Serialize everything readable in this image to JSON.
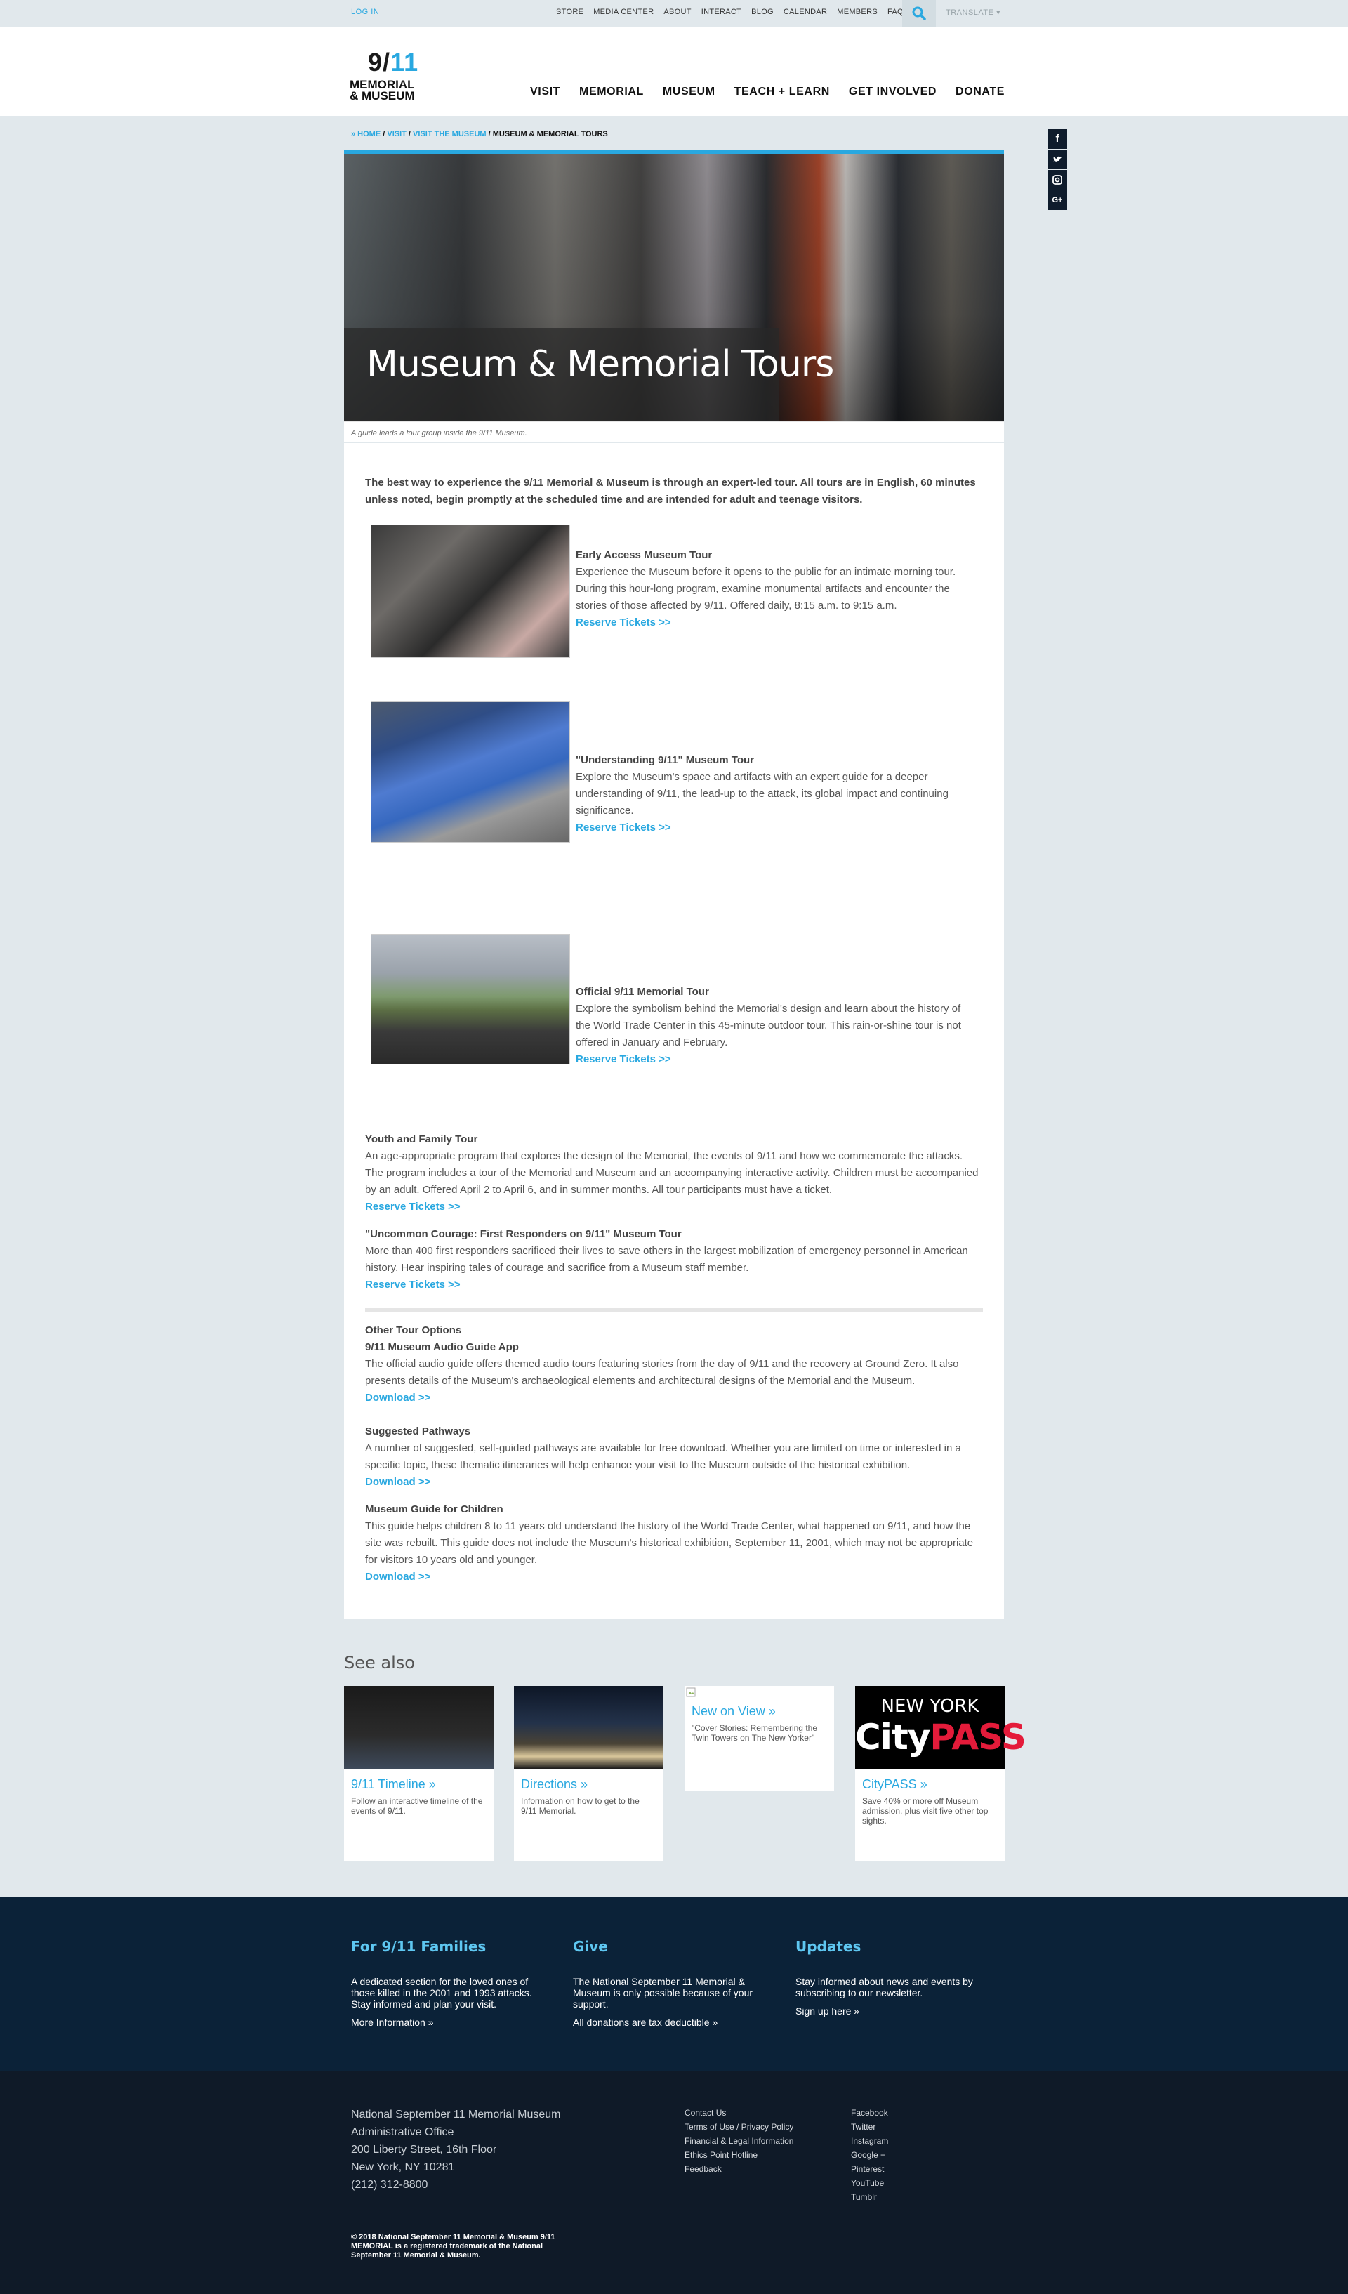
{
  "util": {
    "login": "LOG IN",
    "nav": [
      "STORE",
      "MEDIA CENTER",
      "ABOUT",
      "INTERACT",
      "BLOG",
      "CALENDAR",
      "MEMBERS",
      "FAQ"
    ],
    "translate": "TRANSLATE ▾"
  },
  "logo": {
    "line1": "9/",
    "line1_accent": "11",
    "line2": "MEMORIAL",
    "line3": "& MUSEUM"
  },
  "nav": [
    "VISIT",
    "MEMORIAL",
    "MUSEUM",
    "TEACH + LEARN",
    "GET INVOLVED",
    "DONATE"
  ],
  "social": [
    "f",
    "t",
    "ig",
    "G+"
  ],
  "breadcrumb": {
    "home": "» HOME",
    "sep": " / ",
    "visit": "VISIT",
    "visit_museum": "VISIT THE MUSEUM",
    "current": "MUSEUM & MEMORIAL TOURS"
  },
  "hero": {
    "title": "Museum & Memorial Tours",
    "caption": "A guide leads a tour group inside the 9/11 Museum."
  },
  "intro": "The best way to experience the 9/11 Memorial & Museum is through an expert-led tour. All tours are in English, 60 minutes unless noted, begin promptly at the scheduled time and are intended for adult and teenage visitors.",
  "tours": [
    {
      "title": "Early Access Museum Tour",
      "text": "Experience the Museum before it opens to the public for an intimate morning tour. During this hour-long program, examine monumental artifacts and encounter the stories of those affected by 9/11. Offered daily, 8:15 a.m. to 9:15 a.m.",
      "link": "Reserve Tickets >>"
    },
    {
      "title": "\"Understanding 9/11\" Museum Tour",
      "text": "Explore the Museum's space and artifacts with an expert guide for a deeper understanding of 9/11, the lead-up to the attack, its global impact and continuing significance.",
      "link": "Reserve Tickets >>"
    },
    {
      "title": "Official 9/11 Memorial Tour",
      "text": "Explore the symbolism behind the Memorial's design and learn about the history of the World Trade Center in this 45-minute outdoor tour. This rain-or-shine tour is not offered in January and February.",
      "link": "Reserve Tickets >>"
    },
    {
      "title": "Youth and Family Tour",
      "text": "An age-appropriate program that explores the design of the Memorial, the events of 9/11 and how we commemorate the attacks. The program includes a tour of the Memorial and Museum and an accompanying interactive activity. Children must be accompanied by an adult. Offered April 2 to April 6, and in summer months. All tour participants must have a ticket.",
      "link": "Reserve Tickets >>"
    },
    {
      "title": "\"Uncommon Courage: First Responders on 9/11\" Museum Tour",
      "text": "More than 400 first responders sacrificed their lives to save others in the largest mobilization of emergency personnel in American history. Hear inspiring tales of courage and sacrifice from a Museum staff member.",
      "link": "Reserve Tickets >>"
    }
  ],
  "other": {
    "heading": "Other Tour Options",
    "items": [
      {
        "title": "9/11 Museum Audio Guide App",
        "text": "The official audio guide offers themed audio tours featuring stories from the day of 9/11 and the recovery at Ground Zero. It also presents details of the Museum's archaeological elements and architectural designs of the Memorial and the Museum.",
        "link": "Download >>"
      },
      {
        "title": "Suggested Pathways",
        "text": "A number of suggested, self-guided pathways are available for free download. Whether you are limited on time or interested in a specific topic, these thematic itineraries will help enhance your visit to the Museum outside of the historical exhibition.",
        "link": "Download >>"
      },
      {
        "title": "Museum Guide for Children",
        "text": "This guide helps children 8 to 11 years old understand the history of the World Trade Center, what happened on 9/11, and how the site was rebuilt. This guide does not include the Museum's historical exhibition, September 11, 2001, which may not be appropriate for visitors 10 years old and younger.",
        "link": "Download >>"
      }
    ]
  },
  "seealso": {
    "title": "See also",
    "cards": [
      {
        "title": "9/11 Timeline »",
        "desc": "Follow an interactive timeline of the events of 9/11."
      },
      {
        "title": "Directions »",
        "desc": "Information on how to get to the 9/11 Memorial."
      },
      {
        "title": "New on View »",
        "desc": "\"Cover Stories: Remembering the Twin Towers on The New Yorker\""
      },
      {
        "title": "CityPASS »",
        "desc": "Save 40% or more off Museum admission, plus visit five other top sights.",
        "thumb_top": "NEW YORK",
        "thumb_city": "City",
        "thumb_pass": "PASS"
      }
    ]
  },
  "footer": {
    "families": {
      "title": "For 9/11 Families",
      "text": "A dedicated section for the loved ones of those killed in the 2001 and 1993 attacks. Stay informed and plan your visit.",
      "link": "More Information »"
    },
    "give": {
      "title": "Give",
      "text": "The National September 11 Memorial & Museum is only possible because of your support.",
      "link": "All donations are tax deductible »"
    },
    "updates": {
      "title": "Updates",
      "text": "Stay informed about news and events by subscribing to our newsletter.",
      "link": "Sign up here »"
    },
    "address": [
      "National September 11 Memorial Museum",
      "Administrative Office",
      "200 Liberty Street, 16th Floor",
      "New York, NY 10281",
      "(212) 312-8800"
    ],
    "links1": [
      "Contact Us",
      "Terms of Use / Privacy Policy",
      "Financial & Legal Information",
      "Ethics Point Hotline",
      "Feedback"
    ],
    "links2": [
      "Facebook",
      "Twitter",
      "Instagram",
      "Google +",
      "Pinterest",
      "YouTube",
      "Tumblr"
    ],
    "copyright": "© 2018 National September 11 Memorial & Museum 9/11 MEMORIAL is a registered trademark of the National September 11 Memorial & Museum."
  },
  "colors": {
    "accent": "#29a8e0",
    "footer_dark": "#0b2238",
    "footer_darker": "#0f1a28",
    "page_bg": "#e1e8ec"
  }
}
